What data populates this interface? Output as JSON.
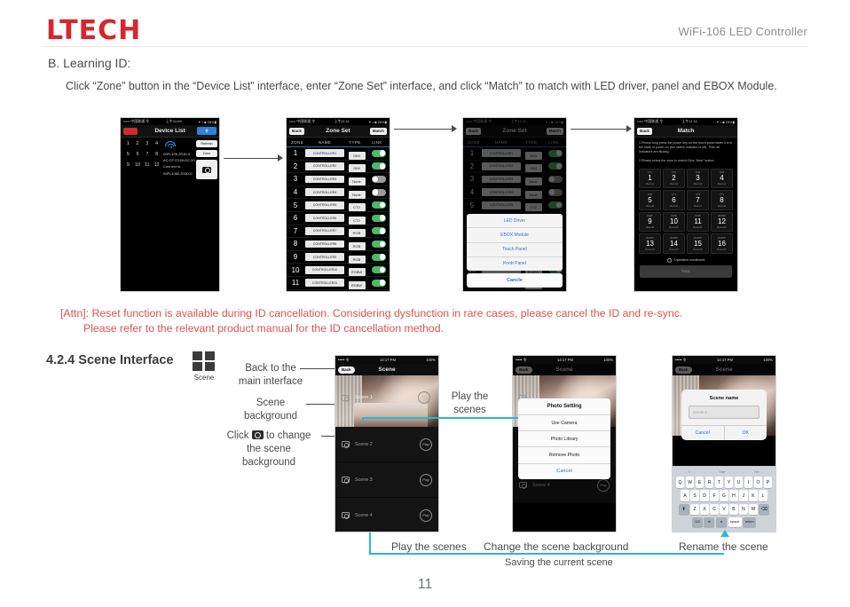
{
  "header": {
    "logo": "LTECH",
    "product": "WiFi-106 LED Controller"
  },
  "section_b": {
    "heading": "B. Learning ID:",
    "paragraph": "Click “Zone” button in the “Device List” interface, enter “Zone Set” interface, and click “Match” to match with LED driver, panel and EBOX Module."
  },
  "attention": {
    "line1": "[Attn]: Reset function is available during ID cancellation. Considering dysfunction in rare cases, please cancel the ID and re-sync.",
    "line2": "Please refer to the relevant product manual for the  ID cancellation method."
  },
  "section_424": {
    "heading": "4.2.4 Scene Interface",
    "icon_label": "Scene"
  },
  "page_number": "11",
  "device_list_phone": {
    "status_bar": {
      "left": "••••• 中国联通 令",
      "center": "上午11:09",
      "right": "✶ • ■ 28%▮"
    },
    "nav": {
      "back_icon": "red-back-button",
      "title": "Device List",
      "search_icon": "search-icon"
    },
    "numbers": [
      [
        "1",
        "2",
        "3",
        "4"
      ],
      [
        "5",
        "6",
        "7",
        "8"
      ],
      [
        "9",
        "10",
        "11",
        "12"
      ]
    ],
    "wifi_icon": "wifi-icon",
    "device_lines": [
      "WiFi-106-SSID-0",
      "AC:CF:23:50:DC:20",
      "Connect to",
      "WiFi-1080-SSID-0"
    ],
    "buttons": {
      "refresh": "Refresh",
      "zone": "Zone",
      "camera": "camera-icon"
    }
  },
  "zone_set_phone": {
    "status_bar": {
      "left": "••••• 中国联通 令",
      "center": "上午11:11",
      "right": "✶ • ■ 25%▮"
    },
    "nav": {
      "back": "Back",
      "title": "Zone Set",
      "match": "Match"
    },
    "columns": [
      "ZONE",
      "NAME",
      "TYPE",
      "LINK"
    ],
    "rows": [
      {
        "zone": "1",
        "name": "CONTROLLER1",
        "type": "DIM",
        "link": "on"
      },
      {
        "zone": "2",
        "name": "CONTROLLER2",
        "type": "DIM",
        "link": "on"
      },
      {
        "zone": "3",
        "name": "CONTROLLER3",
        "type": "None",
        "link": "off"
      },
      {
        "zone": "4",
        "name": "CONTROLLER4",
        "type": "None",
        "link": "off"
      },
      {
        "zone": "5",
        "name": "CONTROLLER5",
        "type": "CT2",
        "link": "on"
      },
      {
        "zone": "6",
        "name": "CONTROLLER6",
        "type": "CT2",
        "link": "on"
      },
      {
        "zone": "7",
        "name": "CONTROLLER7",
        "type": "RGB",
        "link": "on"
      },
      {
        "zone": "8",
        "name": "CONTROLLER8",
        "type": "RGB",
        "link": "on"
      },
      {
        "zone": "9",
        "name": "CONTROLLER9",
        "type": "RGB",
        "link": "on"
      },
      {
        "zone": "10",
        "name": "CONTROLLER10",
        "type": "RGBW",
        "link": "on"
      },
      {
        "zone": "11",
        "name": "CONTROLLER11",
        "type": "RGBW",
        "link": "on"
      }
    ]
  },
  "zone_set_sheet_phone": {
    "sheet_items": [
      "LED Driver",
      "EBOX Module",
      "Touch Panel",
      "Knob Panel"
    ],
    "cancel": "Cancle"
  },
  "match_phone": {
    "status_bar": {
      "left": "••••• 中国联通 令",
      "center": "上午11:11",
      "right": "✶ • ■ 23%▮"
    },
    "nav": {
      "back": "Back",
      "title": "Match"
    },
    "instruction1": "1.Please long press the power key on the touch panel when it is in the state of power-on (the switch indicator is off). Then all indicators are flicking.",
    "instruction2": "2.Please select the zone to match.Click “Next” button.",
    "cells": [
      {
        "top": "ZT1",
        "n": "1",
        "sub": "Room1"
      },
      {
        "top": "ZT2",
        "n": "2",
        "sub": "Room2"
      },
      {
        "top": "DIM",
        "n": "3",
        "sub": "Room3"
      },
      {
        "top": "DIM",
        "n": "4",
        "sub": "Room4"
      },
      {
        "top": "DIM",
        "n": "5",
        "sub": "Room5"
      },
      {
        "top": "CT1",
        "n": "6",
        "sub": "Room6"
      },
      {
        "top": "CT2",
        "n": "7",
        "sub": "Room7"
      },
      {
        "top": "CT2",
        "n": "8",
        "sub": "Room8"
      },
      {
        "top": "RGB",
        "n": "9",
        "sub": "Room9"
      },
      {
        "top": "RGB",
        "n": "10",
        "sub": "Room10"
      },
      {
        "top": "RGB",
        "n": "11",
        "sub": "Room11"
      },
      {
        "top": "RGBW",
        "n": "12",
        "sub": "Room12"
      },
      {
        "top": "RGBW",
        "n": "13",
        "sub": "Room13"
      },
      {
        "top": "RGBW",
        "n": "14",
        "sub": "Room14"
      },
      {
        "top": "RGBW",
        "n": "15",
        "sub": "Room15"
      },
      {
        "top": "RGBW",
        "n": "16",
        "sub": "Room16"
      }
    ],
    "confirm_label": "Operation confirmed",
    "next_button": "Next"
  },
  "scene_phone": {
    "status_bar": {
      "left": "••••• 令",
      "center": "14:17 PM",
      "right": "100%"
    },
    "nav": {
      "back": "Back",
      "title": "Scene"
    },
    "hero": {
      "name": "Scene 1",
      "camera_icon": "camera-icon",
      "play": "Play"
    },
    "rows": [
      {
        "name": "Scene 2",
        "play": "Play"
      },
      {
        "name": "Scene 3",
        "play": "Play"
      },
      {
        "name": "Scene 4",
        "play": "Play"
      }
    ]
  },
  "photo_setting_phone": {
    "sheet_title": "Photo Setting",
    "items": [
      "Use Camera",
      "Photo Library",
      "Remove Photo"
    ],
    "cancel": "Cancel",
    "bottom_row": {
      "name": "Scene 4",
      "play": "Play"
    }
  },
  "rename_phone": {
    "status_bar": {
      "center": "14:17 PM",
      "right": "100%"
    },
    "dialog": {
      "title": "Scene name",
      "input_placeholder": "Scene 1",
      "cancel": "Cancel",
      "ok": "OK"
    },
    "keyboard": {
      "suggest": [
        "I",
        "The",
        "I'm"
      ],
      "row1": [
        "Q",
        "W",
        "E",
        "R",
        "T",
        "Y",
        "U",
        "I",
        "O",
        "P"
      ],
      "row2": [
        "A",
        "S",
        "D",
        "F",
        "G",
        "H",
        "J",
        "K",
        "L"
      ],
      "row3_shift": "⬆",
      "row3": [
        "Z",
        "X",
        "C",
        "V",
        "B",
        "N",
        "M"
      ],
      "row3_back": "⌫",
      "row4_num": "123",
      "row4_globe": "⊕",
      "row4_mic": "⏺",
      "row4_space": "space",
      "row4_return": "return"
    }
  },
  "annotations": {
    "back_main": "Back to the\nmain interface",
    "scene_background": "Scene\nbackground",
    "click_change_pre": "Click",
    "click_change_post": "to change",
    "click_change_l2": "the scene",
    "click_change_l3": "background",
    "play_scenes_side": "Play the\nscenes",
    "cap_play": "Play the scenes",
    "cap_change": "Change the scene background",
    "cap_rename": "Rename the scene",
    "cap_saving": "Saving the current scene"
  },
  "colors": {
    "brand_red": "#d8262c",
    "attention_red": "#d9534f",
    "accent_cyan": "#29b6d8",
    "toggle_green": "#4bb96a",
    "ios_blue": "#2f6fd0"
  }
}
